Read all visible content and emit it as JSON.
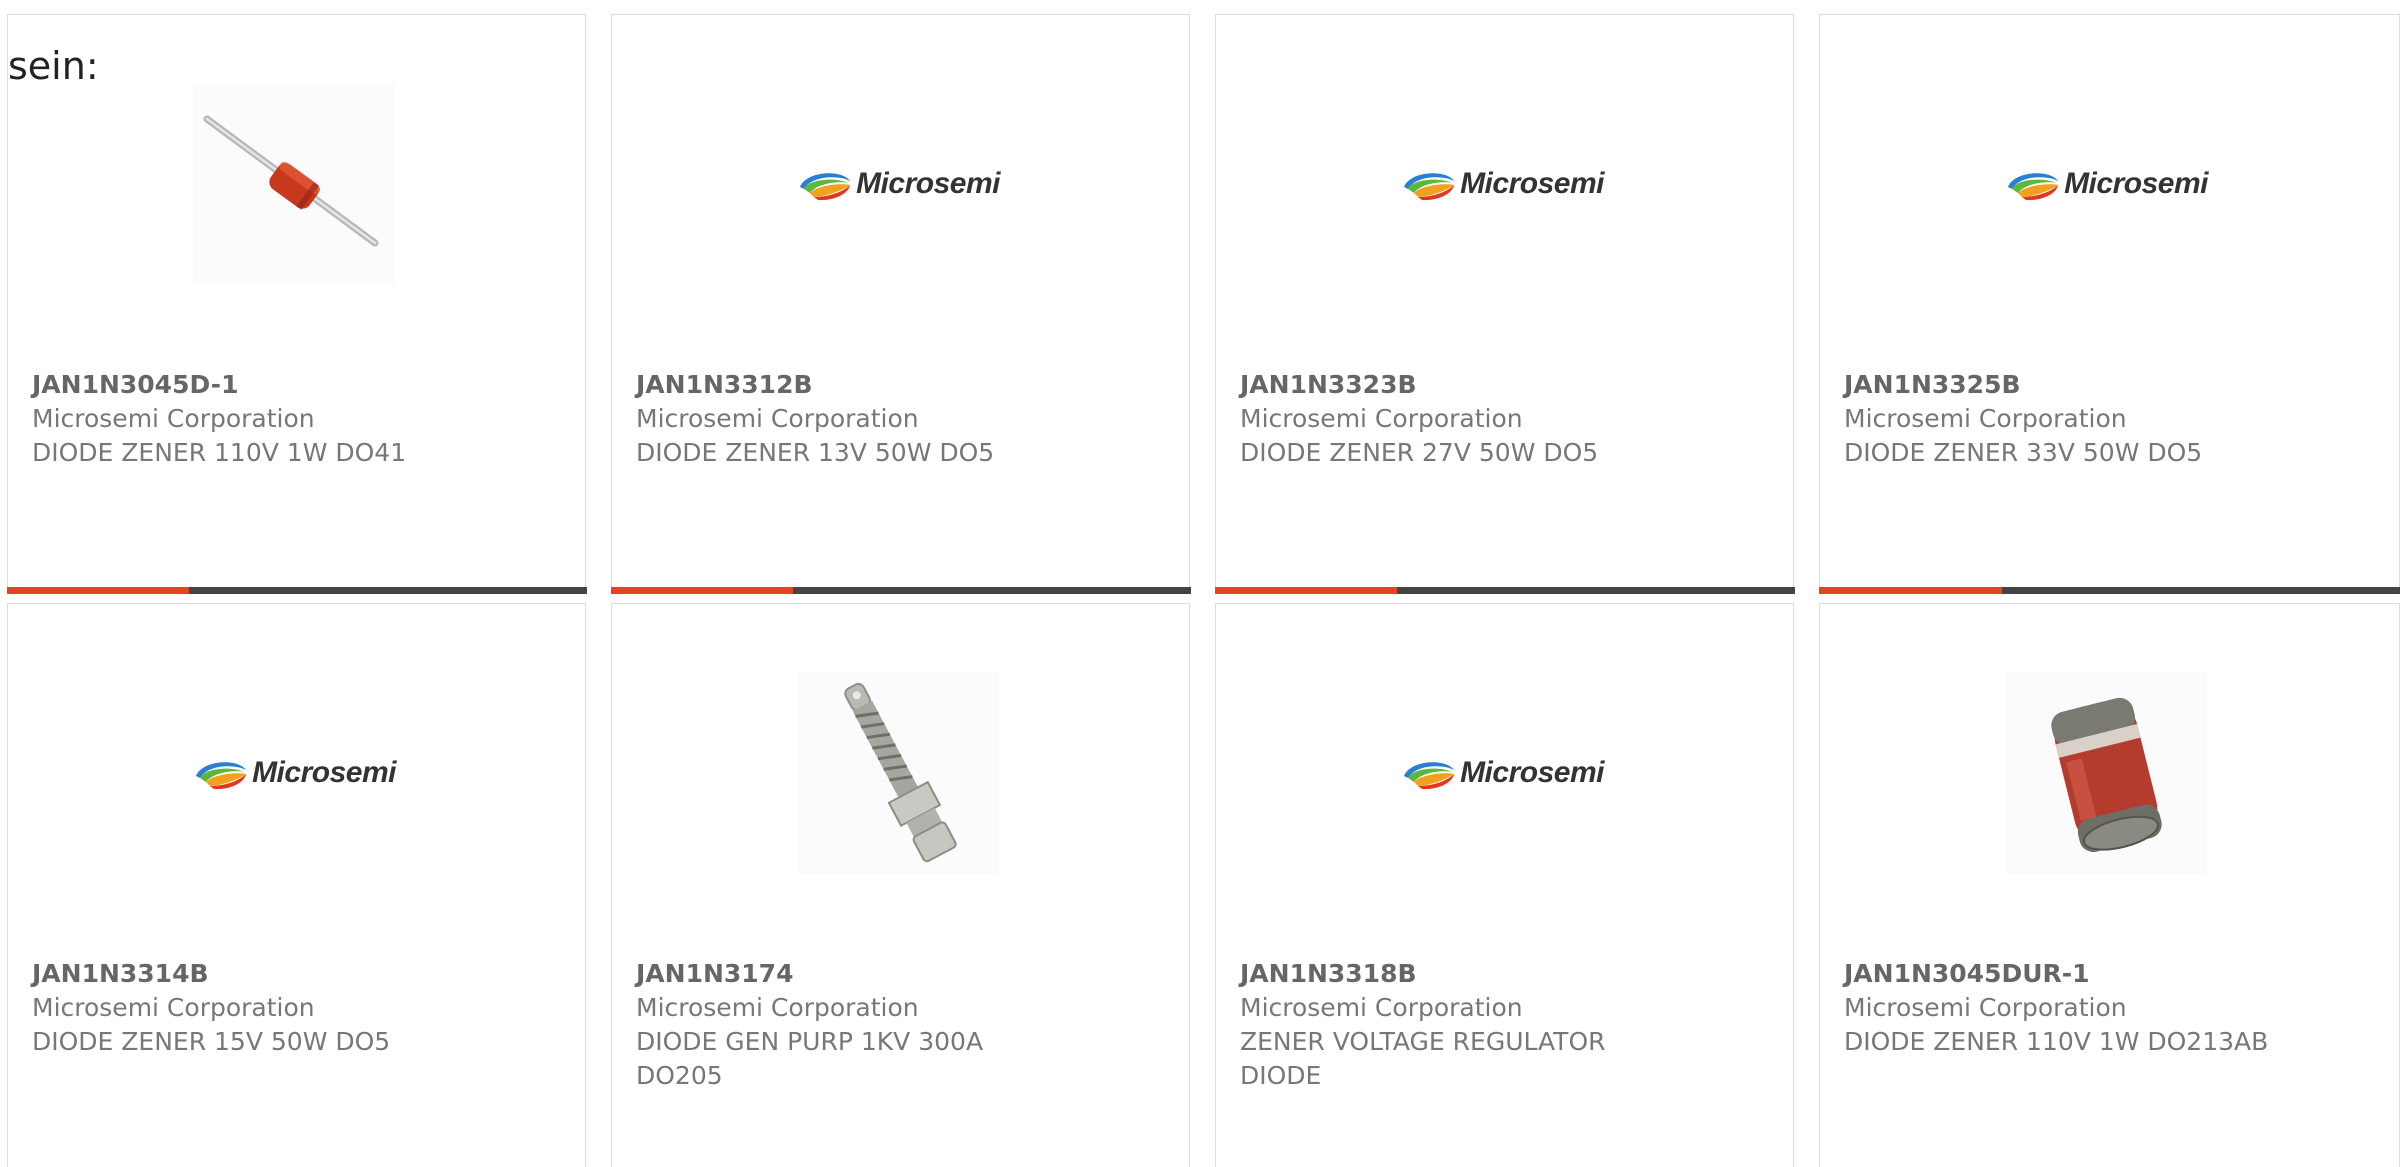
{
  "intro_text": "sein:",
  "colors": {
    "accent": "#e8421f",
    "bar": "#444444",
    "card_border": "#dcdcdc",
    "text": "#666666"
  },
  "products": [
    {
      "part_number": "JAN1N3045D-1",
      "manufacturer": "Microsemi Corporation",
      "description": "DIODE ZENER 110V 1W DO41",
      "image": "axial-diode-icon"
    },
    {
      "part_number": "JAN1N3312B",
      "manufacturer": "Microsemi Corporation",
      "description": "DIODE ZENER 13V 50W DO5",
      "image": "microsemi-logo",
      "logo_text": "Microsemi"
    },
    {
      "part_number": "JAN1N3323B",
      "manufacturer": "Microsemi Corporation",
      "description": "DIODE ZENER 27V 50W DO5",
      "image": "microsemi-logo",
      "logo_text": "Microsemi"
    },
    {
      "part_number": "JAN1N3325B",
      "manufacturer": "Microsemi Corporation",
      "description": "DIODE ZENER 33V 50W DO5",
      "image": "microsemi-logo",
      "logo_text": "Microsemi"
    },
    {
      "part_number": "JAN1N3314B",
      "manufacturer": "Microsemi Corporation",
      "description": "DIODE ZENER 15V 50W DO5",
      "image": "microsemi-logo",
      "logo_text": "Microsemi"
    },
    {
      "part_number": "JAN1N3174",
      "manufacturer": "Microsemi Corporation",
      "description": "DIODE GEN PURP 1KV 300A DO205",
      "image": "stud-diode-icon"
    },
    {
      "part_number": "JAN1N3318B",
      "manufacturer": "Microsemi Corporation",
      "description": "ZENER VOLTAGE REGULATOR DIODE",
      "image": "microsemi-logo",
      "logo_text": "Microsemi"
    },
    {
      "part_number": "JAN1N3045DUR-1",
      "manufacturer": "Microsemi Corporation",
      "description": "DIODE ZENER 110V 1W DO213AB",
      "image": "melf-diode-icon"
    }
  ]
}
